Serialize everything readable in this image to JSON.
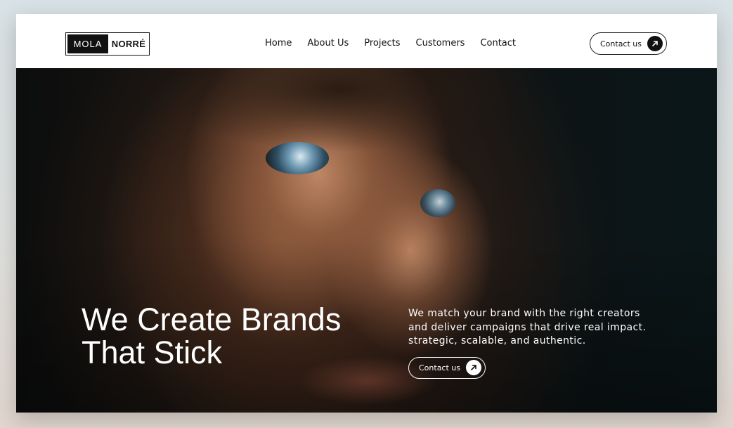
{
  "brand": {
    "left_word": "MOLA",
    "right_word": "NORRÉ"
  },
  "nav": {
    "items": [
      {
        "label": "Home"
      },
      {
        "label": "About Us"
      },
      {
        "label": "Projects"
      },
      {
        "label": "Customers"
      },
      {
        "label": "Contact"
      }
    ]
  },
  "header": {
    "cta_label": "Contact us",
    "cta_icon": "arrow-up-right-icon"
  },
  "hero": {
    "headline_line1": "We Create Brands",
    "headline_line2": "That Stick",
    "blurb_lines": [
      "We match your brand with the right creators",
      "and deliver campaigns that drive real impact.",
      "strategic, scalable, and authentic."
    ],
    "cta_label": "Contact us",
    "cta_icon": "arrow-up-right-icon",
    "image": "close-up portrait of freckled face with blue eyes"
  },
  "colors": {
    "text_dark": "#111111",
    "header_bg": "#ffffff",
    "hero_text": "#ffffff"
  }
}
